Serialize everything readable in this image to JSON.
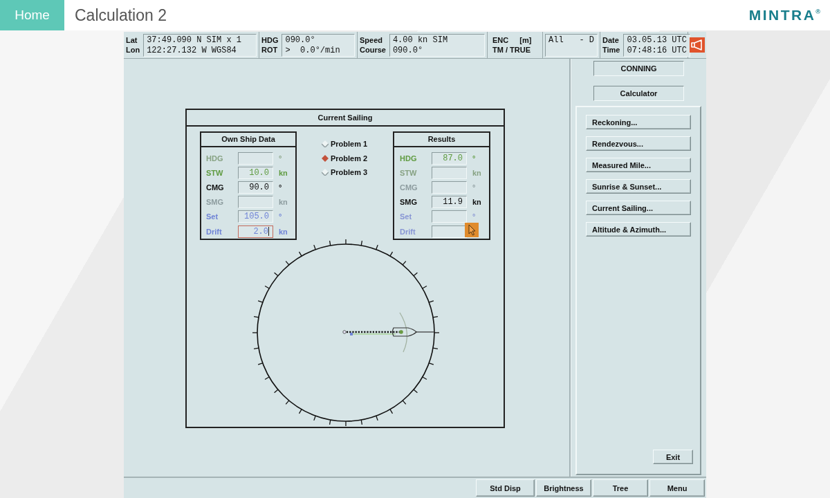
{
  "header": {
    "home_button": "Home",
    "title": "Calculation 2",
    "logo": "MINTRA$^{®}$"
  },
  "status_bar": [
    {
      "kind": "readout",
      "rows": [
        {
          "label": "Lat",
          "value": "37:49.090 N SIM x 1"
        },
        {
          "label": "Lon",
          "value": "122:27.132 W WGS84"
        }
      ]
    },
    {
      "kind": "readout",
      "rows": [
        {
          "label": "HDG",
          "value": "090.0°"
        },
        {
          "label": "ROT",
          "value": ">  0.0°/min"
        }
      ]
    },
    {
      "kind": "readout",
      "rows": [
        {
          "label": "Speed",
          "value": "4.00 kn SIM"
        },
        {
          "label": "Course",
          "value": "090.0°"
        }
      ]
    },
    {
      "kind": "mode",
      "lines": [
        [
          "ENC",
          "[m]"
        ],
        [
          "TM / TRUE"
        ]
      ]
    },
    {
      "kind": "filter",
      "parts": [
        "All",
        "- D"
      ]
    },
    {
      "kind": "readout",
      "rows": [
        {
          "label": "Date",
          "value": "03.05.13 UTC"
        },
        {
          "label": "Time",
          "value": "07:48:16 UTC"
        }
      ]
    }
  ],
  "calculator": {
    "title": "Current Sailing",
    "own_ship_data": {
      "title": "Own Ship Data",
      "rows": [
        {
          "label": "HDG",
          "unit": "°",
          "color": "#87a283",
          "focused": false
        },
        {
          "label": "STW",
          "value": "10.0",
          "unit": "kn",
          "color": "#5f9b40",
          "focused": false
        },
        {
          "label": "CMG",
          "value": "90.0",
          "unit": "°",
          "color": "#111111",
          "focused": false
        },
        {
          "label": "SMG",
          "unit": "kn",
          "color": "#8d9c9f",
          "focused": false
        },
        {
          "label": "Set",
          "value": "105.0",
          "unit": "°",
          "color": "#6f83d6",
          "focused": false
        },
        {
          "label": "Drift",
          "value": "2.0",
          "unit": "kn",
          "color": "#6f83d6",
          "focused": true
        }
      ]
    },
    "problems": [
      {
        "label": "Problem 1",
        "selected": false
      },
      {
        "label": "Problem 2",
        "selected": true
      },
      {
        "label": "Problem 3",
        "selected": false
      }
    ],
    "results": {
      "title": "Results",
      "rows": [
        {
          "label": "HDG",
          "value": "87.0",
          "unit": "°",
          "color": "#5f9b40",
          "focused": false
        },
        {
          "label": "STW",
          "unit": "kn",
          "color": "#87a283",
          "focused": false
        },
        {
          "label": "CMG",
          "unit": "°",
          "color": "#8d9c9f",
          "focused": false
        },
        {
          "label": "SMG",
          "value": "11.9",
          "unit": "kn",
          "color": "#111111",
          "focused": false
        },
        {
          "label": "Set",
          "unit": "°",
          "color": "#8795d4",
          "focused": false
        },
        {
          "label": "Drift",
          "color": "#8795d4",
          "focused": false
        }
      ]
    }
  },
  "side_panel": {
    "mode_buttons": [
      "CONNING",
      "Calculator"
    ],
    "calculations": [
      "Reckoning...",
      "Rendezvous...",
      "Measured Mile...",
      "Sunrise & Sunset...",
      "Current Sailing...",
      "Altitude & Azimuth..."
    ],
    "exit_button": "Exit"
  },
  "bottom_bar": [
    "Std Disp",
    "Brightness",
    "Tree",
    "Menu"
  ]
}
